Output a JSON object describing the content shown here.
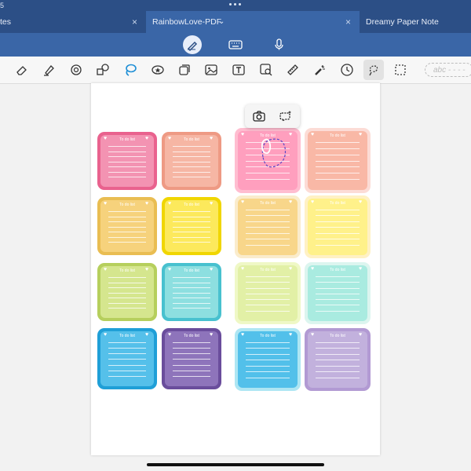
{
  "status": {
    "time": "5"
  },
  "tabs": [
    {
      "label": "tes",
      "close": "×"
    },
    {
      "label": "RainbowLove-PDF",
      "chevron": "⌄",
      "close": "×"
    },
    {
      "label": "Dreamy Paper Note"
    }
  ],
  "toolbar": {
    "text_placeholder": "abc - - - -",
    "top_icons": [
      "handwriting-pen-icon",
      "keyboard-icon",
      "microphone-icon"
    ],
    "tools": [
      "eraser-icon",
      "highlighter-icon",
      "tape-icon",
      "shapes-icon",
      "lasso-icon",
      "sticker-icon",
      "element-icon",
      "image-icon",
      "text-box-icon",
      "image-search-icon",
      "ruler-icon",
      "laser-pointer-icon",
      "clock-icon",
      "lasso-freeform-icon",
      "selection-box-icon"
    ]
  },
  "popup": {
    "icons": [
      "camera-icon",
      "ai-lasso-icon"
    ]
  },
  "note_title": "To do list",
  "notes": [
    {
      "outer": "#e9628e",
      "inner": "#f393b2"
    },
    {
      "outer": "#ee9a84",
      "inner": "#f6b6a4"
    },
    {
      "outer": "#ffbdd0",
      "inner": "#ff9fbe"
    },
    {
      "outer": "#fcdcd6",
      "inner": "#f9b8a6"
    },
    {
      "outer": "#e9bd52",
      "inner": "#f6d27c"
    },
    {
      "outer": "#f0d600",
      "inner": "#fce95c"
    },
    {
      "outer": "#faeccc",
      "inner": "#f8d68a"
    },
    {
      "outer": "#fff1c4",
      "inner": "#fff18a"
    },
    {
      "outer": "#b6cf5d",
      "inner": "#d5e68e"
    },
    {
      "outer": "#48c1cf",
      "inner": "#8ddfe0"
    },
    {
      "outer": "#eff8c6",
      "inner": "#e2f0a6"
    },
    {
      "outer": "#dcf5ef",
      "inner": "#a9ebe0"
    },
    {
      "outer": "#1f9fd7",
      "inner": "#55c0ea"
    },
    {
      "outer": "#6a4d9c",
      "inner": "#8e74bb"
    },
    {
      "outer": "#aee6f3",
      "inner": "#52c0ea"
    },
    {
      "outer": "#b29ad3",
      "inner": "#c2b1dd"
    }
  ]
}
